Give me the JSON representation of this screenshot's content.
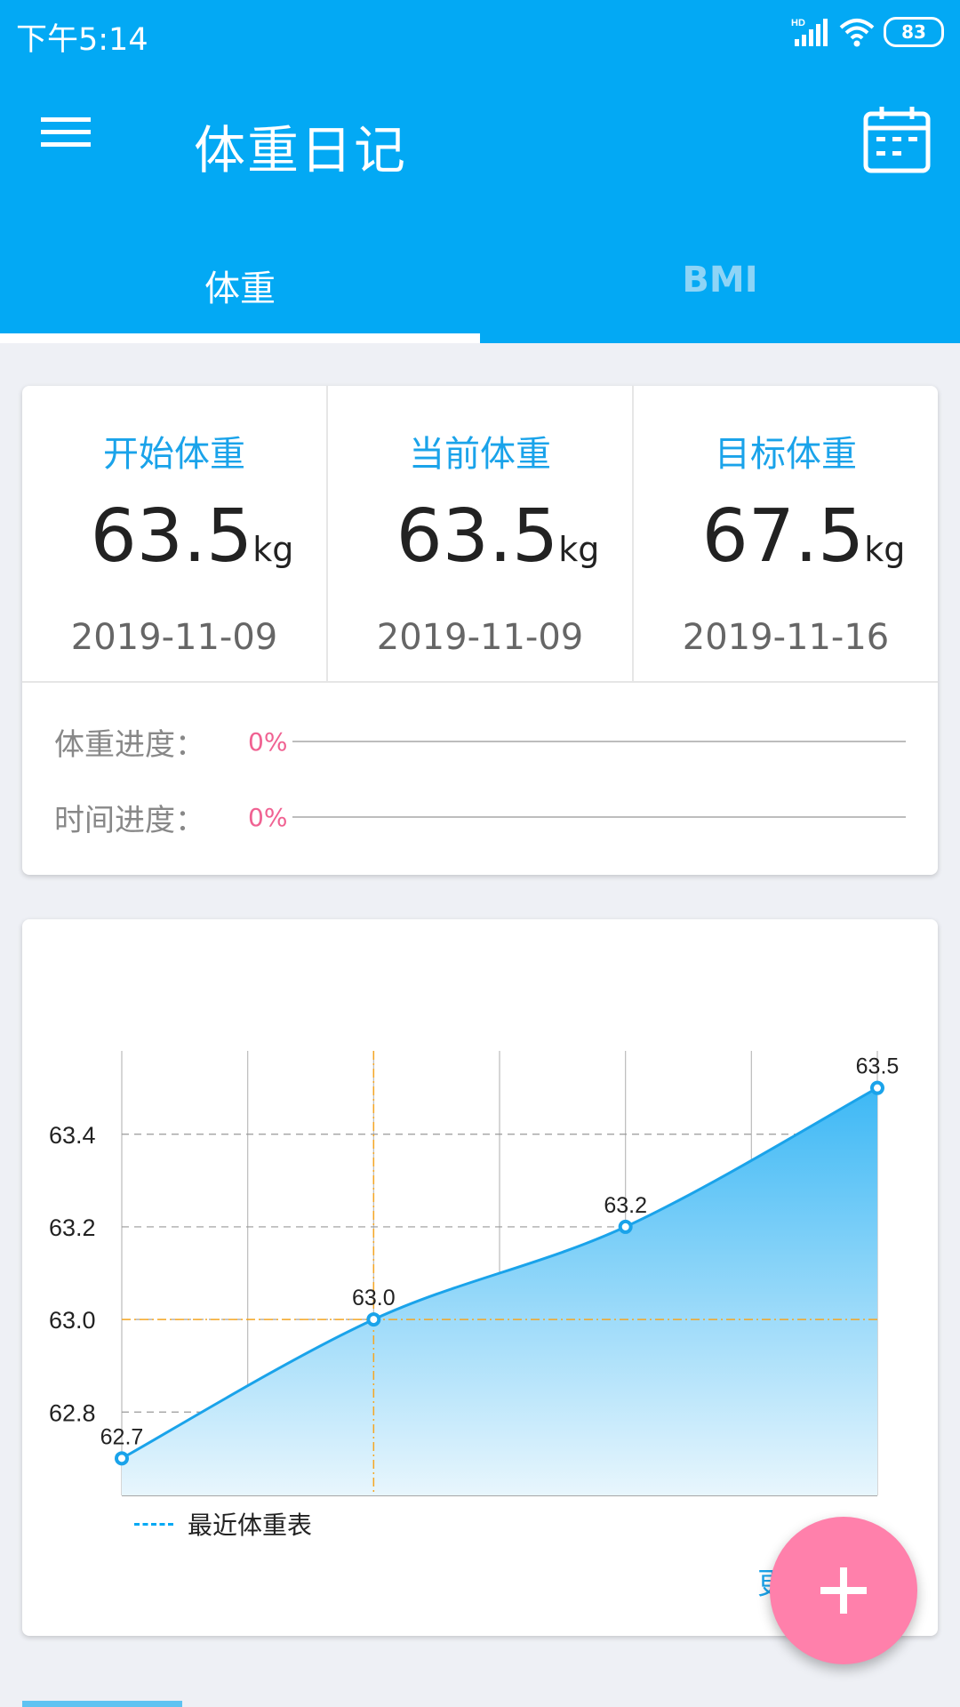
{
  "status_bar": {
    "time": "下午5:14",
    "battery": "83",
    "network": "HD"
  },
  "toolbar": {
    "title": "体重日记",
    "menu_icon": "menu-icon",
    "calendar_icon": "calendar-icon"
  },
  "tabs": [
    {
      "label": "体重",
      "active": true
    },
    {
      "label": "BMI",
      "active": false
    }
  ],
  "summary": {
    "stats": [
      {
        "label": "开始体重",
        "value": "63.5",
        "unit": "kg",
        "date": "2019-11-09"
      },
      {
        "label": "当前体重",
        "value": "63.5",
        "unit": "kg",
        "date": "2019-11-09"
      },
      {
        "label": "目标体重",
        "value": "67.5",
        "unit": "kg",
        "date": "2019-11-16"
      }
    ],
    "progress": [
      {
        "label": "体重进度：",
        "percent": "0%",
        "value": 0
      },
      {
        "label": "时间进度：",
        "percent": "0%",
        "value": 0
      }
    ]
  },
  "chart_data": {
    "type": "area",
    "x": [
      0,
      2,
      4,
      6
    ],
    "series": [
      {
        "name": "最近体重表",
        "values": [
          62.7,
          63.0,
          63.2,
          63.5
        ]
      }
    ],
    "data_labels": [
      "62.7",
      "63.0",
      "63.2",
      "63.5"
    ],
    "y_ticks": [
      "62.8",
      "63.0",
      "63.2",
      "63.4"
    ],
    "xlim": [
      0,
      6
    ],
    "ylim": [
      62.62,
      63.58
    ],
    "grid": true,
    "highlight": {
      "x": 2,
      "y": 63.0
    },
    "legend_position": "bottom-left",
    "colors": {
      "line": "#1aa3ea",
      "highlight": "#f5a623",
      "fill_top": "#3db8f5",
      "fill_bottom": "#e8f6fd"
    }
  },
  "chart_card": {
    "more_label": "更"
  },
  "colors": {
    "primary": "#03a9f4",
    "accent": "#ff80ab",
    "progress": "#f06292"
  }
}
